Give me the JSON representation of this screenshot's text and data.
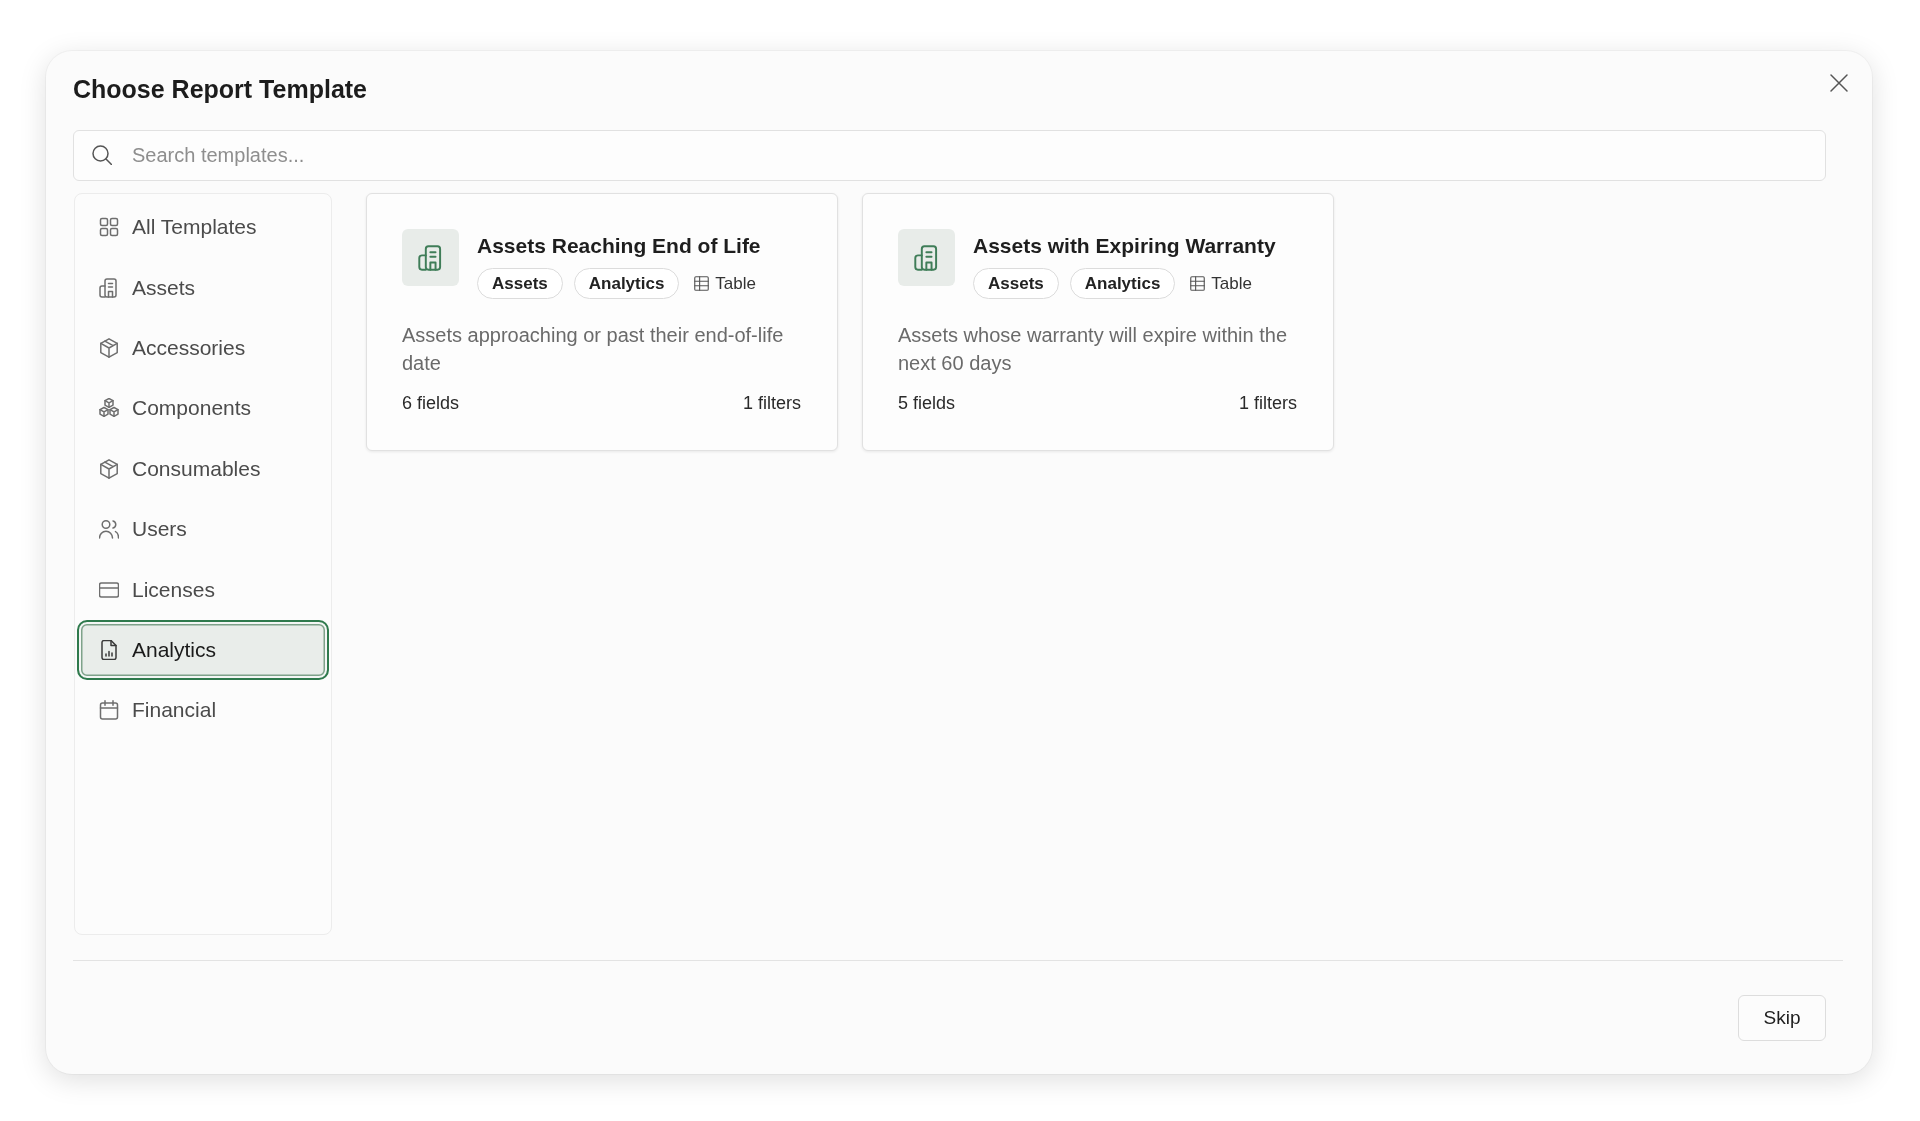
{
  "dialog": {
    "title": "Choose Report Template"
  },
  "search": {
    "placeholder": "Search templates..."
  },
  "sidebar": {
    "items": [
      {
        "label": "All Templates",
        "selected": false
      },
      {
        "label": "Assets",
        "selected": false
      },
      {
        "label": "Accessories",
        "selected": false
      },
      {
        "label": "Components",
        "selected": false
      },
      {
        "label": "Consumables",
        "selected": false
      },
      {
        "label": "Users",
        "selected": false
      },
      {
        "label": "Licenses",
        "selected": false
      },
      {
        "label": "Analytics",
        "selected": true
      },
      {
        "label": "Financial",
        "selected": false
      }
    ]
  },
  "templates": [
    {
      "title": "Assets Reaching End of Life",
      "tags": [
        "Assets",
        "Analytics"
      ],
      "format": "Table",
      "description": "Assets approaching or past their end-of-life date",
      "fields": "6 fields",
      "filters": "1 filters"
    },
    {
      "title": "Assets with Expiring Warranty",
      "tags": [
        "Assets",
        "Analytics"
      ],
      "format": "Table",
      "description": "Assets whose warranty will expire within the next 60 days",
      "fields": "5 fields",
      "filters": "1 filters"
    }
  ],
  "footer": {
    "buttons": [
      "Skip"
    ]
  }
}
